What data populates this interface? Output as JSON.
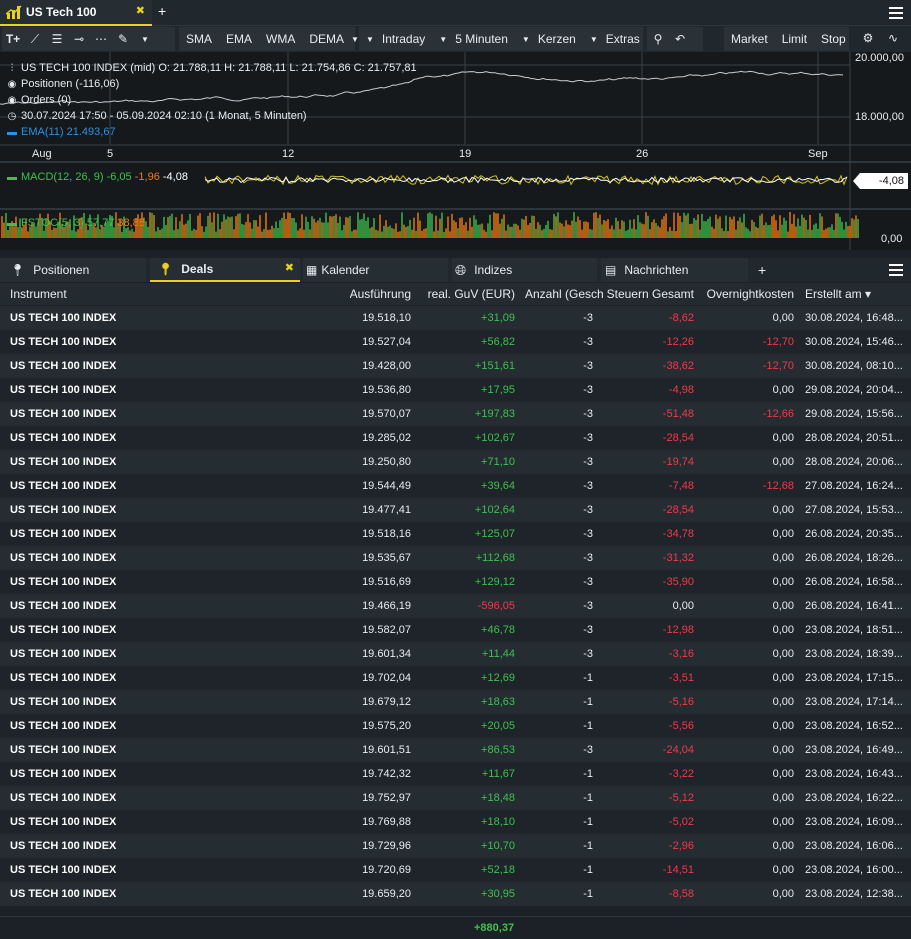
{
  "window": {
    "tab_title": "US Tech 100",
    "tab_close": "✖",
    "add_tab": "+"
  },
  "toolbar": {
    "items": [
      "SMA",
      "EMA",
      "WMA",
      "DEMA"
    ],
    "interval": "Intraday",
    "period": "5 Minuten",
    "chart_type": "Kerzen",
    "extras": "Extras",
    "order_buttons": [
      "Market",
      "Limit",
      "Stop"
    ]
  },
  "chart": {
    "instrument_line": "US TECH 100 INDEX (mid)  O: 21.788,11  H: 21.788,11  L: 21.754,86  C: 21.757,81",
    "positions_line": "Positionen (-116,06)",
    "orders_line": "Orders (0)",
    "range_line": "30.07.2024 17:50 - 05.09.2024 02:10  (1 Monat, 5 Minuten)",
    "ema_line": "EMA(11)  21.493,67",
    "macd_label": "MACD(12, 26, 9)",
    "macd_values": [
      "-6,05",
      "-1,96",
      "-4,08"
    ],
    "fstoc_label": "FSTOC(5, 3)",
    "fstoc_values": [
      "57,77",
      "38,88"
    ],
    "y_labels": [
      "20.000,00",
      "18.000,00"
    ],
    "x_labels": [
      "Aug",
      "5",
      "12",
      "19",
      "26",
      "Sep"
    ],
    "macd_tag": "-4,08",
    "fstoc_axis": "0,00",
    "colors": {
      "price": "#c8ccd0",
      "ema": "#2f8fe0",
      "macd": "#d8c21a",
      "signal": "#ffffff",
      "fstoc_k": "#3ec14f",
      "fstoc_d": "#f07d12"
    }
  },
  "panel_tabs": [
    {
      "label": "Positionen",
      "icon": "pin-icon"
    },
    {
      "label": "Deals",
      "icon": "pin-icon",
      "close": "✖"
    },
    {
      "label": "Kalender",
      "icon": "calendar-icon"
    },
    {
      "label": "Indizes",
      "icon": "globe-icon"
    },
    {
      "label": "Nachrichten",
      "icon": "news-icon"
    },
    {
      "label": "+",
      "icon": ""
    }
  ],
  "table": {
    "headers": [
      "Instrument",
      "Ausführung",
      "real. GuV (EUR)",
      "Anzahl (Geschl",
      "Steuern Gesamt",
      "Overnightkosten",
      "Erstellt am ▾"
    ],
    "rows": [
      [
        "US TECH 100 INDEX",
        "19.518,10",
        "+31,09",
        "-3",
        "-8,62",
        "0,00",
        "30.08.2024, 16:48..."
      ],
      [
        "US TECH 100 INDEX",
        "19.527,04",
        "+56,82",
        "-3",
        "-12,26",
        "-12,70",
        "30.08.2024, 15:46..."
      ],
      [
        "US TECH 100 INDEX",
        "19.428,00",
        "+151,61",
        "-3",
        "-38,62",
        "-12,70",
        "30.08.2024, 08:10..."
      ],
      [
        "US TECH 100 INDEX",
        "19.536,80",
        "+17,95",
        "-3",
        "-4,98",
        "0,00",
        "29.08.2024, 20:04..."
      ],
      [
        "US TECH 100 INDEX",
        "19.570,07",
        "+197,83",
        "-3",
        "-51,48",
        "-12,66",
        "29.08.2024, 15:56..."
      ],
      [
        "US TECH 100 INDEX",
        "19.285,02",
        "+102,67",
        "-3",
        "-28,54",
        "0,00",
        "28.08.2024, 20:51..."
      ],
      [
        "US TECH 100 INDEX",
        "19.250,80",
        "+71,10",
        "-3",
        "-19,74",
        "0,00",
        "28.08.2024, 20:06..."
      ],
      [
        "US TECH 100 INDEX",
        "19.544,49",
        "+39,64",
        "-3",
        "-7,48",
        "-12,68",
        "27.08.2024, 16:24..."
      ],
      [
        "US TECH 100 INDEX",
        "19.477,41",
        "+102,64",
        "-3",
        "-28,54",
        "0,00",
        "27.08.2024, 15:53..."
      ],
      [
        "US TECH 100 INDEX",
        "19.518,16",
        "+125,07",
        "-3",
        "-34,78",
        "0,00",
        "26.08.2024, 20:35..."
      ],
      [
        "US TECH 100 INDEX",
        "19.535,67",
        "+112,68",
        "-3",
        "-31,32",
        "0,00",
        "26.08.2024, 18:26..."
      ],
      [
        "US TECH 100 INDEX",
        "19.516,69",
        "+129,12",
        "-3",
        "-35,90",
        "0,00",
        "26.08.2024, 16:58..."
      ],
      [
        "US TECH 100 INDEX",
        "19.466,19",
        "-596,05",
        "-3",
        "0,00",
        "0,00",
        "26.08.2024, 16:41..."
      ],
      [
        "US TECH 100 INDEX",
        "19.582,07",
        "+46,78",
        "-3",
        "-12,98",
        "0,00",
        "23.08.2024, 18:51..."
      ],
      [
        "US TECH 100 INDEX",
        "19.601,34",
        "+11,44",
        "-3",
        "-3,16",
        "0,00",
        "23.08.2024, 18:39..."
      ],
      [
        "US TECH 100 INDEX",
        "19.702,04",
        "+12,69",
        "-1",
        "-3,51",
        "0,00",
        "23.08.2024, 17:15..."
      ],
      [
        "US TECH 100 INDEX",
        "19.679,12",
        "+18,63",
        "-1",
        "-5,16",
        "0,00",
        "23.08.2024, 17:14..."
      ],
      [
        "US TECH 100 INDEX",
        "19.575,20",
        "+20,05",
        "-1",
        "-5,56",
        "0,00",
        "23.08.2024, 16:52..."
      ],
      [
        "US TECH 100 INDEX",
        "19.601,51",
        "+86,53",
        "-3",
        "-24,04",
        "0,00",
        "23.08.2024, 16:49..."
      ],
      [
        "US TECH 100 INDEX",
        "19.742,32",
        "+11,67",
        "-1",
        "-3,22",
        "0,00",
        "23.08.2024, 16:43..."
      ],
      [
        "US TECH 100 INDEX",
        "19.752,97",
        "+18,48",
        "-1",
        "-5,12",
        "0,00",
        "23.08.2024, 16:22..."
      ],
      [
        "US TECH 100 INDEX",
        "19.769,88",
        "+18,10",
        "-1",
        "-5,02",
        "0,00",
        "23.08.2024, 16:09..."
      ],
      [
        "US TECH 100 INDEX",
        "19.729,96",
        "+10,70",
        "-1",
        "-2,96",
        "0,00",
        "23.08.2024, 16:06..."
      ],
      [
        "US TECH 100 INDEX",
        "19.720,69",
        "+52,18",
        "-1",
        "-14,51",
        "0,00",
        "23.08.2024, 16:00..."
      ],
      [
        "US TECH 100 INDEX",
        "19.659,20",
        "+30,95",
        "-1",
        "-8,58",
        "0,00",
        "23.08.2024, 12:38..."
      ]
    ],
    "total_pnl": "+880,37"
  }
}
